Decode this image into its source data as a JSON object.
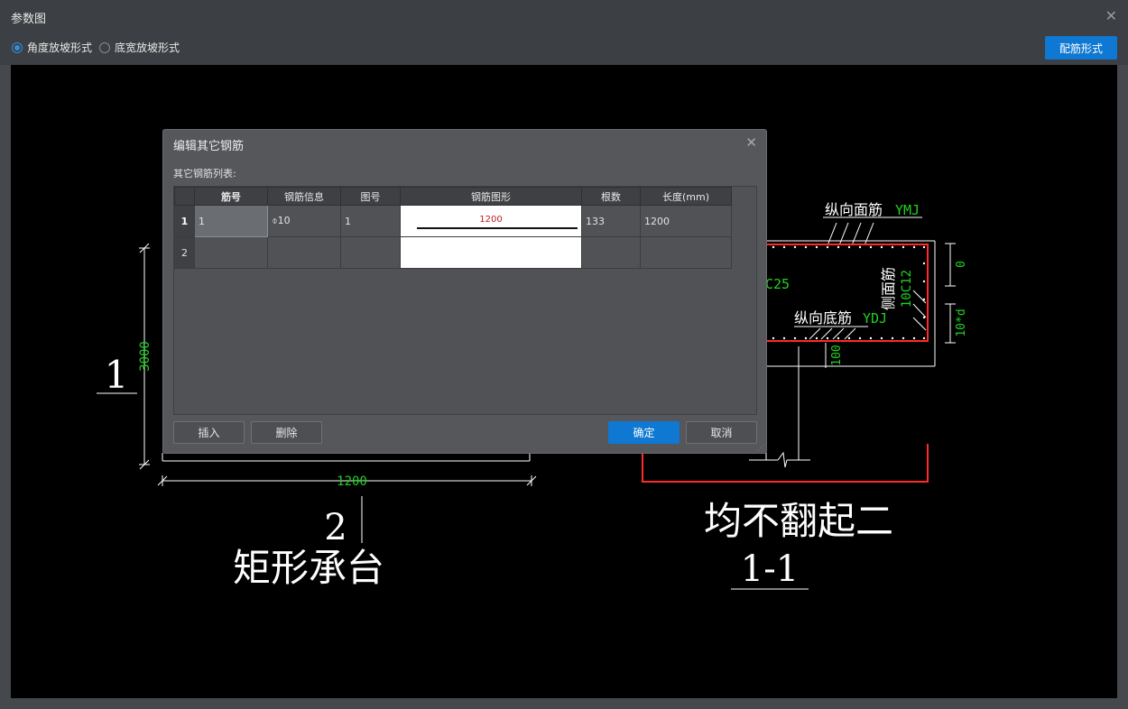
{
  "window": {
    "title": "参数图",
    "close_icon": "close-icon"
  },
  "options": {
    "radios": [
      {
        "label": "角度放坡形式",
        "checked": true
      },
      {
        "label": "底宽放坡形式",
        "checked": false
      }
    ],
    "rebar_form_button": "配筋形式"
  },
  "drawing": {
    "left_dim_vertical": "3000",
    "left_label_1": "1",
    "bottom_dim": "1200",
    "label_2": "2",
    "title_left": "矩形承台",
    "top_rebar_label": "纵向面筋",
    "top_rebar_code": "YMJ",
    "bottom_rebar_label": "纵向底筋",
    "bottom_rebar_code": "YDJ",
    "side_rebar_label": "侧面筋",
    "side_rebar_spec": "10C12",
    "partial_c25": "C25",
    "dim_zero": "0",
    "dim_10d": "10*d",
    "dim_100": "100",
    "title_right": "均不翻起二",
    "section_label": "1-1",
    "colors": {
      "dim_green": "#22d022",
      "rebar_red": "#ff2a2a",
      "line_white": "#ffffff"
    }
  },
  "dialog": {
    "title": "编辑其它钢筋",
    "subtitle": "其它钢筋列表:",
    "columns": [
      "筋号",
      "钢筋信息",
      "图号",
      "钢筋图形",
      "根数",
      "长度(mm)"
    ],
    "rows": [
      {
        "num": "1",
        "jinhao": "1",
        "info": "⌽10",
        "tuhao": "1",
        "shape_label": "1200",
        "count": "133",
        "length": "1200"
      },
      {
        "num": "2",
        "jinhao": "",
        "info": "",
        "tuhao": "",
        "shape_label": "",
        "count": "",
        "length": ""
      }
    ],
    "buttons": {
      "insert": "插入",
      "delete": "删除",
      "ok": "确定",
      "cancel": "取消"
    }
  }
}
